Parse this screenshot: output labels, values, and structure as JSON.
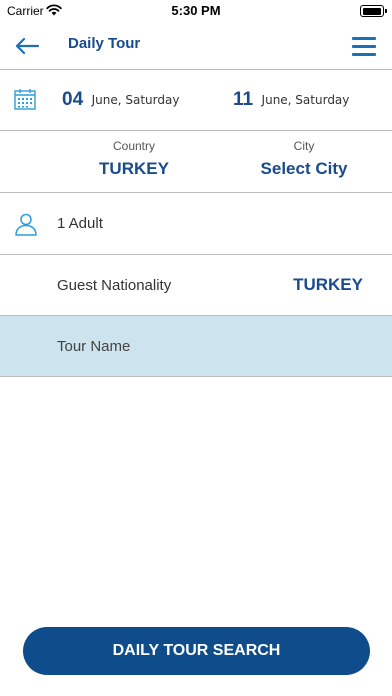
{
  "status_bar": {
    "carrier": "Carrier",
    "time": "5:30 PM"
  },
  "header": {
    "title": "Daily Tour"
  },
  "dates": {
    "start": {
      "day": "04",
      "label": "June, Saturday"
    },
    "end": {
      "day": "11",
      "label": "June, Saturday"
    }
  },
  "location": {
    "country_caption": "Country",
    "country_value": "TURKEY",
    "city_caption": "City",
    "city_value": "Select City"
  },
  "guests": {
    "text": "1 Adult"
  },
  "nationality": {
    "label": "Guest Nationality",
    "value": "TURKEY"
  },
  "tour_name": {
    "placeholder": "Tour Name"
  },
  "search_button": {
    "label": "DAILY TOUR SEARCH"
  },
  "colors": {
    "primary": "#1a4b8c",
    "accent": "#1d6fb8",
    "highlight_row": "#cde3ee",
    "button": "#0f4c8c"
  }
}
